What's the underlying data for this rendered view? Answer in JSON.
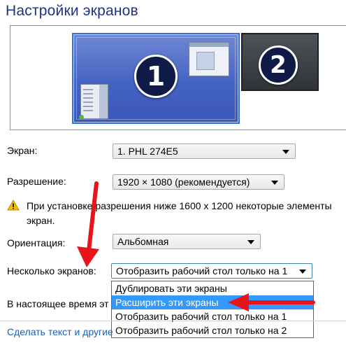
{
  "window": {
    "title": "Настройки экранов"
  },
  "preview": {
    "monitors": [
      {
        "number": "1"
      },
      {
        "number": "2"
      }
    ]
  },
  "screen": {
    "label": "Экран:",
    "value": "1. PHL 274E5"
  },
  "resolution": {
    "label": "Разрешение:",
    "value": "1920 × 1080 (рекомендуется)"
  },
  "warning": {
    "icon": "warning-icon",
    "text": "При установке разрешения ниже 1600 х 1200 некоторые элементы экран."
  },
  "orientation": {
    "label": "Ориентация:",
    "value": "Альбомная"
  },
  "multiple_displays": {
    "label": "Несколько экранов:",
    "value": "Отобразить рабочий стол только на 1",
    "options": [
      "Дублировать эти экраны",
      "Расширить эти экраны",
      "Отобразить рабочий стол только на 1",
      "Отобразить рабочий стол только на 2"
    ],
    "selected_option": "Расширить эти экраны"
  },
  "current_note": {
    "text": "В настоящее время эт"
  },
  "link": {
    "text": "Сделать текст и другие"
  },
  "colors": {
    "accent_title": "#1e3287",
    "selection": "#3399ff",
    "annotation_arrow": "#e8141c",
    "link": "#1e5db8"
  }
}
